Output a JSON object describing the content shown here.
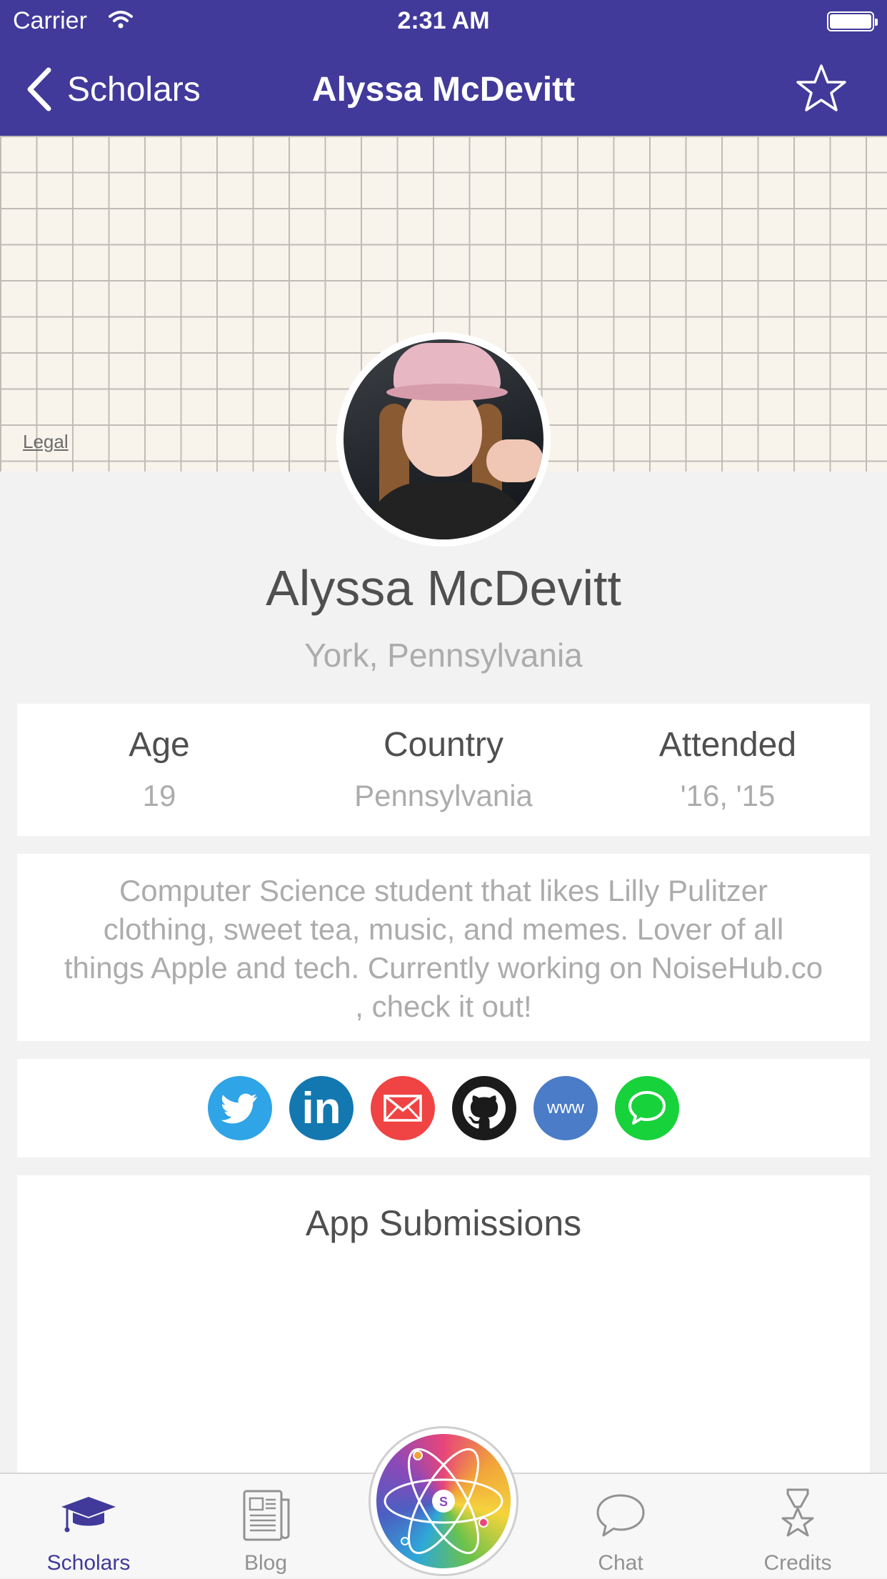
{
  "status_bar": {
    "carrier": "Carrier",
    "time": "2:31 AM"
  },
  "nav": {
    "back_label": "Scholars",
    "title": "Alyssa McDevitt",
    "star_icon": "star-outline-icon"
  },
  "header": {
    "legal_link": "Legal"
  },
  "profile": {
    "name": "Alyssa McDevitt",
    "location": "York, Pennsylvania",
    "stats": [
      {
        "label": "Age",
        "value": "19"
      },
      {
        "label": "Country",
        "value": "Pennsylvania"
      },
      {
        "label": "Attended",
        "value": "'16, '15"
      }
    ],
    "bio": "Computer Science student that likes Lilly Pulitzer clothing, sweet tea, music, and memes. Lover of all things Apple and tech. Currently working on NoiseHub.co , check it out!"
  },
  "social": {
    "items": [
      {
        "name": "twitter",
        "icon": "twitter-bird-icon",
        "color": "#2fa4e7"
      },
      {
        "name": "linkedin",
        "icon": "linkedin-icon",
        "label": "in",
        "color": "#1378b0"
      },
      {
        "name": "email",
        "icon": "envelope-icon",
        "color": "#f04343"
      },
      {
        "name": "github",
        "icon": "github-octocat-icon",
        "color": "#1b1b1b"
      },
      {
        "name": "website",
        "icon": "www-icon",
        "label": "www",
        "color": "#4a7cc7"
      },
      {
        "name": "message",
        "icon": "chat-bubble-icon",
        "color": "#17d23a"
      }
    ]
  },
  "apps": {
    "title": "App Submissions"
  },
  "tabs": [
    {
      "label": "Scholars",
      "icon": "graduation-cap-icon",
      "active": true
    },
    {
      "label": "Blog",
      "icon": "newspaper-icon",
      "active": false
    },
    {
      "label": "",
      "icon": "atom-logo-icon",
      "active": false
    },
    {
      "label": "Chat",
      "icon": "speech-bubble-icon",
      "active": false
    },
    {
      "label": "Credits",
      "icon": "award-star-icon",
      "active": false
    }
  ],
  "colors": {
    "brand": "#413a9a",
    "background": "#f2f2f2",
    "muted_text": "#acacac",
    "dark_text": "#4f4f4f"
  }
}
